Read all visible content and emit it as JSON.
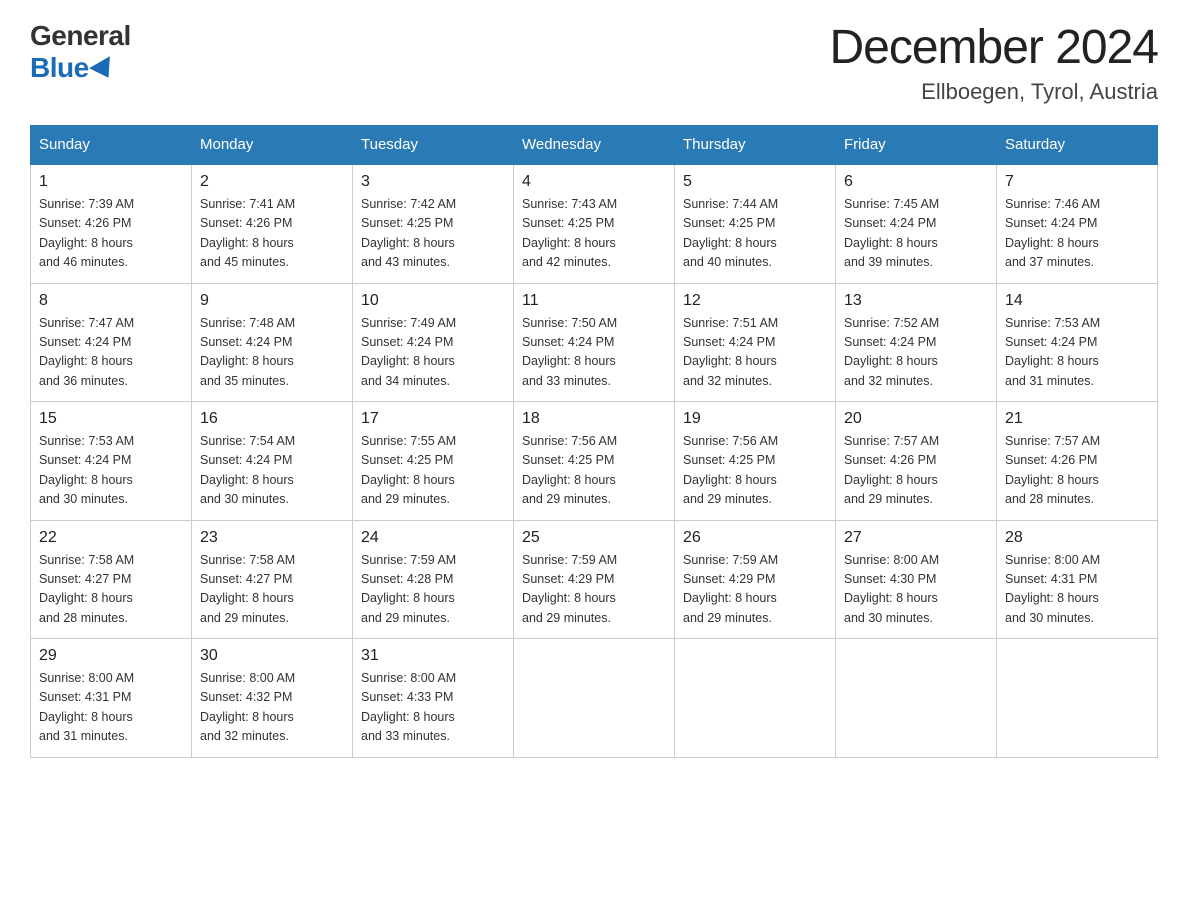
{
  "logo": {
    "general": "General",
    "blue": "Blue"
  },
  "title": "December 2024",
  "location": "Ellboegen, Tyrol, Austria",
  "days_of_week": [
    "Sunday",
    "Monday",
    "Tuesday",
    "Wednesday",
    "Thursday",
    "Friday",
    "Saturday"
  ],
  "weeks": [
    [
      {
        "day": "1",
        "sunrise": "7:39 AM",
        "sunset": "4:26 PM",
        "daylight": "8 hours and 46 minutes."
      },
      {
        "day": "2",
        "sunrise": "7:41 AM",
        "sunset": "4:26 PM",
        "daylight": "8 hours and 45 minutes."
      },
      {
        "day": "3",
        "sunrise": "7:42 AM",
        "sunset": "4:25 PM",
        "daylight": "8 hours and 43 minutes."
      },
      {
        "day": "4",
        "sunrise": "7:43 AM",
        "sunset": "4:25 PM",
        "daylight": "8 hours and 42 minutes."
      },
      {
        "day": "5",
        "sunrise": "7:44 AM",
        "sunset": "4:25 PM",
        "daylight": "8 hours and 40 minutes."
      },
      {
        "day": "6",
        "sunrise": "7:45 AM",
        "sunset": "4:24 PM",
        "daylight": "8 hours and 39 minutes."
      },
      {
        "day": "7",
        "sunrise": "7:46 AM",
        "sunset": "4:24 PM",
        "daylight": "8 hours and 37 minutes."
      }
    ],
    [
      {
        "day": "8",
        "sunrise": "7:47 AM",
        "sunset": "4:24 PM",
        "daylight": "8 hours and 36 minutes."
      },
      {
        "day": "9",
        "sunrise": "7:48 AM",
        "sunset": "4:24 PM",
        "daylight": "8 hours and 35 minutes."
      },
      {
        "day": "10",
        "sunrise": "7:49 AM",
        "sunset": "4:24 PM",
        "daylight": "8 hours and 34 minutes."
      },
      {
        "day": "11",
        "sunrise": "7:50 AM",
        "sunset": "4:24 PM",
        "daylight": "8 hours and 33 minutes."
      },
      {
        "day": "12",
        "sunrise": "7:51 AM",
        "sunset": "4:24 PM",
        "daylight": "8 hours and 32 minutes."
      },
      {
        "day": "13",
        "sunrise": "7:52 AM",
        "sunset": "4:24 PM",
        "daylight": "8 hours and 32 minutes."
      },
      {
        "day": "14",
        "sunrise": "7:53 AM",
        "sunset": "4:24 PM",
        "daylight": "8 hours and 31 minutes."
      }
    ],
    [
      {
        "day": "15",
        "sunrise": "7:53 AM",
        "sunset": "4:24 PM",
        "daylight": "8 hours and 30 minutes."
      },
      {
        "day": "16",
        "sunrise": "7:54 AM",
        "sunset": "4:24 PM",
        "daylight": "8 hours and 30 minutes."
      },
      {
        "day": "17",
        "sunrise": "7:55 AM",
        "sunset": "4:25 PM",
        "daylight": "8 hours and 29 minutes."
      },
      {
        "day": "18",
        "sunrise": "7:56 AM",
        "sunset": "4:25 PM",
        "daylight": "8 hours and 29 minutes."
      },
      {
        "day": "19",
        "sunrise": "7:56 AM",
        "sunset": "4:25 PM",
        "daylight": "8 hours and 29 minutes."
      },
      {
        "day": "20",
        "sunrise": "7:57 AM",
        "sunset": "4:26 PM",
        "daylight": "8 hours and 29 minutes."
      },
      {
        "day": "21",
        "sunrise": "7:57 AM",
        "sunset": "4:26 PM",
        "daylight": "8 hours and 28 minutes."
      }
    ],
    [
      {
        "day": "22",
        "sunrise": "7:58 AM",
        "sunset": "4:27 PM",
        "daylight": "8 hours and 28 minutes."
      },
      {
        "day": "23",
        "sunrise": "7:58 AM",
        "sunset": "4:27 PM",
        "daylight": "8 hours and 29 minutes."
      },
      {
        "day": "24",
        "sunrise": "7:59 AM",
        "sunset": "4:28 PM",
        "daylight": "8 hours and 29 minutes."
      },
      {
        "day": "25",
        "sunrise": "7:59 AM",
        "sunset": "4:29 PM",
        "daylight": "8 hours and 29 minutes."
      },
      {
        "day": "26",
        "sunrise": "7:59 AM",
        "sunset": "4:29 PM",
        "daylight": "8 hours and 29 minutes."
      },
      {
        "day": "27",
        "sunrise": "8:00 AM",
        "sunset": "4:30 PM",
        "daylight": "8 hours and 30 minutes."
      },
      {
        "day": "28",
        "sunrise": "8:00 AM",
        "sunset": "4:31 PM",
        "daylight": "8 hours and 30 minutes."
      }
    ],
    [
      {
        "day": "29",
        "sunrise": "8:00 AM",
        "sunset": "4:31 PM",
        "daylight": "8 hours and 31 minutes."
      },
      {
        "day": "30",
        "sunrise": "8:00 AM",
        "sunset": "4:32 PM",
        "daylight": "8 hours and 32 minutes."
      },
      {
        "day": "31",
        "sunrise": "8:00 AM",
        "sunset": "4:33 PM",
        "daylight": "8 hours and 33 minutes."
      },
      null,
      null,
      null,
      null
    ]
  ],
  "labels": {
    "sunrise": "Sunrise:",
    "sunset": "Sunset:",
    "daylight": "Daylight:"
  }
}
